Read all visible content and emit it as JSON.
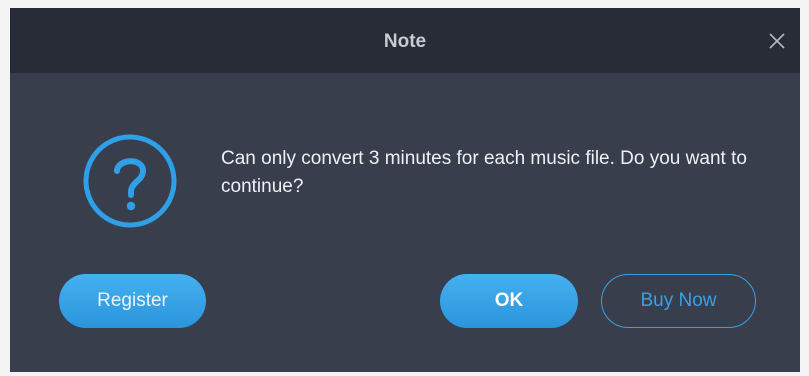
{
  "dialog": {
    "title": "Note",
    "close_icon": "close-icon",
    "icon": "question-circle-icon",
    "message": "Can only convert 3 minutes for each music file. Do you want to continue?",
    "buttons": {
      "register": "Register",
      "ok": "OK",
      "buy_now": "Buy Now"
    }
  },
  "colors": {
    "accent": "#2fa0e8",
    "titlebar": "#272c37",
    "body": "#383e4c"
  }
}
